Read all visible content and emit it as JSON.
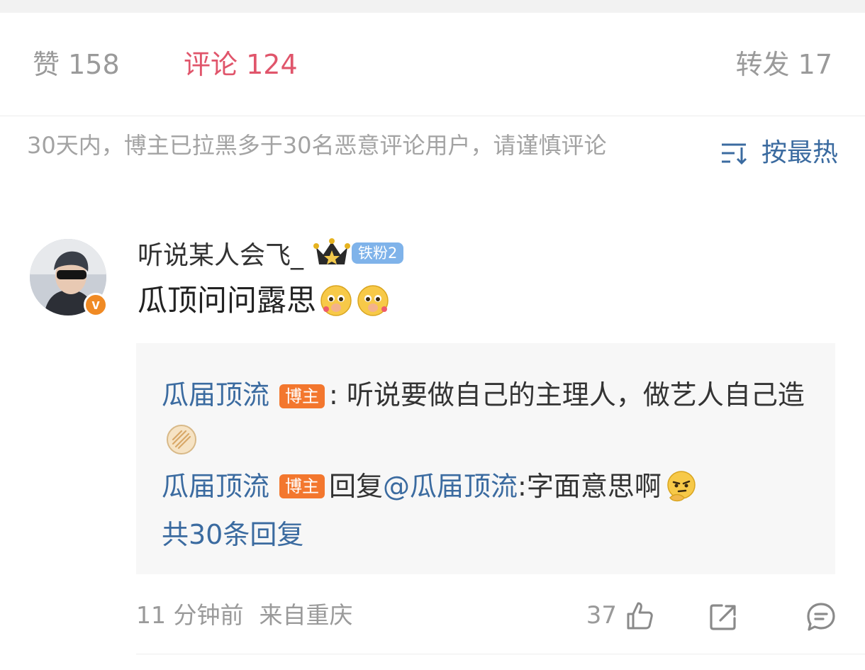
{
  "tabs": {
    "likes_label": "赞",
    "likes_count": "158",
    "comments_label": "评论",
    "comments_count": "124",
    "reposts_label": "转发",
    "reposts_count": "17"
  },
  "notice": "30天内，博主已拉黑多于30名恶意评论用户，请谨慎评论",
  "sort": {
    "label": "按最热",
    "icon": "sort-icon"
  },
  "comment": {
    "username": "听说某人会飞_",
    "verified_mark": "v",
    "fan_badge": "铁粉2",
    "text": "瓜顶问问露思",
    "emojis": [
      "pleading-face-icon",
      "pleading-face-icon"
    ],
    "time": "11 分钟前",
    "location": "来自重庆",
    "like_count": "37"
  },
  "replies": [
    {
      "author": "瓜届顶流",
      "badge": "博主",
      "separator": ":",
      "text": " 听说要做自己的主理人，做艺人自己造",
      "emoji": "pancake-icon"
    },
    {
      "author": "瓜届顶流",
      "badge": "博主",
      "reply_word": "回复",
      "mention": "@瓜届顶流",
      "text": ":字面意思啊",
      "emoji": "thinking-face-icon"
    }
  ],
  "more_replies": "共30条回复",
  "colors": {
    "accent_red": "#e0556b",
    "link_blue": "#3b6ba0",
    "host_badge": "#f3772e",
    "fan_badge": "#7fb3ea",
    "reply_bg": "#f7f7f7"
  }
}
